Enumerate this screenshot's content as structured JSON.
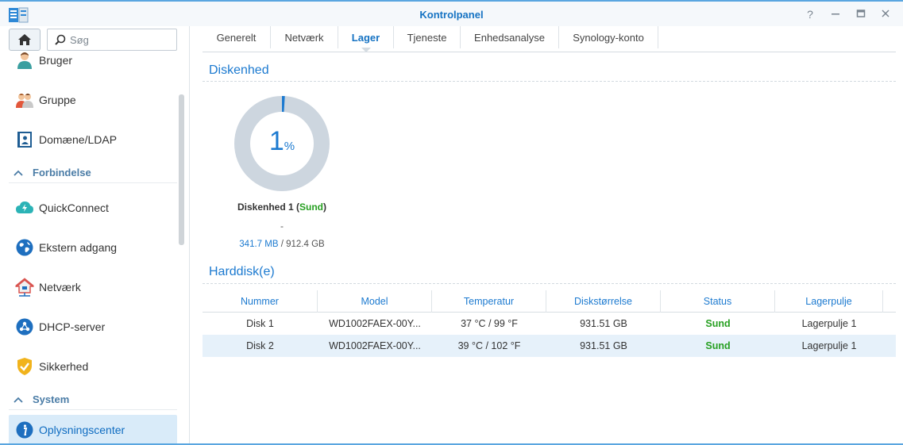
{
  "window": {
    "title": "Kontrolpanel"
  },
  "sidebar": {
    "search_placeholder": "Søg",
    "items": [
      {
        "label": "Bruger",
        "icon": "user-icon"
      },
      {
        "label": "Gruppe",
        "icon": "group-icon"
      },
      {
        "label": "Domæne/LDAP",
        "icon": "domain-ldap-icon"
      },
      {
        "section": "Forbindelse"
      },
      {
        "label": "QuickConnect",
        "icon": "quickconnect-icon"
      },
      {
        "label": "Ekstern adgang",
        "icon": "external-access-icon"
      },
      {
        "label": "Netværk",
        "icon": "network-icon"
      },
      {
        "label": "DHCP-server",
        "icon": "dhcp-server-icon"
      },
      {
        "label": "Sikkerhed",
        "icon": "security-shield-icon"
      },
      {
        "section": "System"
      },
      {
        "label": "Oplysningscenter",
        "icon": "info-icon",
        "active": true
      }
    ]
  },
  "tabs": [
    {
      "label": "Generelt"
    },
    {
      "label": "Netværk"
    },
    {
      "label": "Lager",
      "active": true
    },
    {
      "label": "Tjeneste"
    },
    {
      "label": "Enhedsanalyse"
    },
    {
      "label": "Synology-konto"
    }
  ],
  "disk_unit": {
    "section_title": "Diskenhed",
    "percent": "1",
    "percent_sign": "%",
    "usage_fraction": 0.01,
    "name": "Diskenhed 1",
    "status": "Sund",
    "dash": "-",
    "used": "341.7 MB",
    "total": "912.4 GB"
  },
  "harddisks": {
    "section_title": "Harddisk(e)",
    "columns": [
      "Nummer",
      "Model",
      "Temperatur",
      "Diskstørrelse",
      "Status",
      "Lagerpulje"
    ],
    "rows": [
      [
        "Disk 1",
        "WD1002FAEX-00Y...",
        "37 °C / 99 °F",
        "931.51 GB",
        "Sund",
        "Lagerpulje 1"
      ],
      [
        "Disk 2",
        "WD1002FAEX-00Y...",
        "39 °C / 102 °F",
        "931.51 GB",
        "Sund",
        "Lagerpulje 1"
      ]
    ]
  },
  "colors": {
    "accent": "#1c7ad0",
    "ok": "#27a022",
    "donut_track": "#cdd6df"
  }
}
